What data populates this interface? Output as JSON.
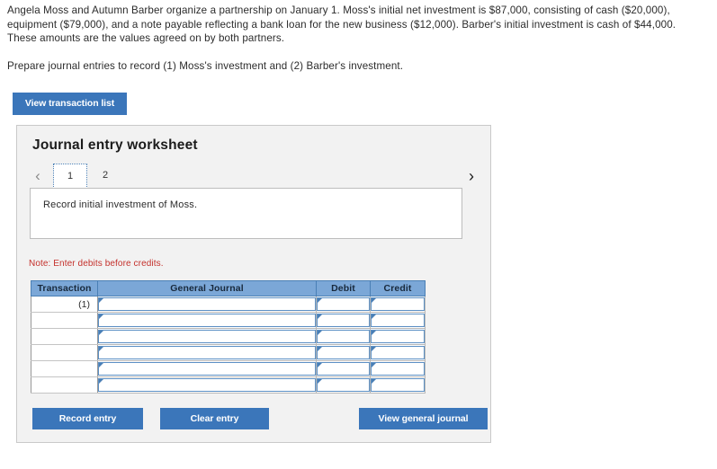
{
  "problem": {
    "paragraph1": "Angela Moss and Autumn Barber organize a partnership on January 1. Moss's initial net investment is $87,000, consisting of cash ($20,000), equipment ($79,000), and a note payable reflecting a bank loan for the new business ($12,000). Barber's initial investment is cash of $44,000. These amounts are the values agreed on by both partners.",
    "paragraph2": "Prepare journal entries to record (1) Moss's investment and (2) Barber's investment."
  },
  "toolbar": {
    "view_transaction_list_label": "View transaction list"
  },
  "worksheet": {
    "title": "Journal entry worksheet",
    "prev_arrow": "‹",
    "next_arrow": "›",
    "tabs": [
      {
        "label": "1",
        "active": true
      },
      {
        "label": "2",
        "active": false
      }
    ],
    "description": "Record initial investment of Moss.",
    "note": "Note: Enter debits before credits."
  },
  "journal_table": {
    "headers": [
      "Transaction",
      "General Journal",
      "Debit",
      "Credit"
    ],
    "rows": [
      {
        "transaction": "(1)",
        "general_journal": "",
        "debit": "",
        "credit": ""
      },
      {
        "transaction": "",
        "general_journal": "",
        "debit": "",
        "credit": ""
      },
      {
        "transaction": "",
        "general_journal": "",
        "debit": "",
        "credit": ""
      },
      {
        "transaction": "",
        "general_journal": "",
        "debit": "",
        "credit": ""
      },
      {
        "transaction": "",
        "general_journal": "",
        "debit": "",
        "credit": ""
      },
      {
        "transaction": "",
        "general_journal": "",
        "debit": "",
        "credit": ""
      }
    ]
  },
  "actions": {
    "record_entry_label": "Record entry",
    "clear_entry_label": "Clear entry",
    "view_general_journal_label": "View general journal"
  },
  "colors": {
    "button_blue": "#3b76ba",
    "table_header_blue": "#7ba7d7",
    "cell_border_blue": "#5b8fc4",
    "note_red": "#c4302b",
    "panel_bg": "#f2f2f2",
    "panel_border": "#c9c9c9"
  }
}
